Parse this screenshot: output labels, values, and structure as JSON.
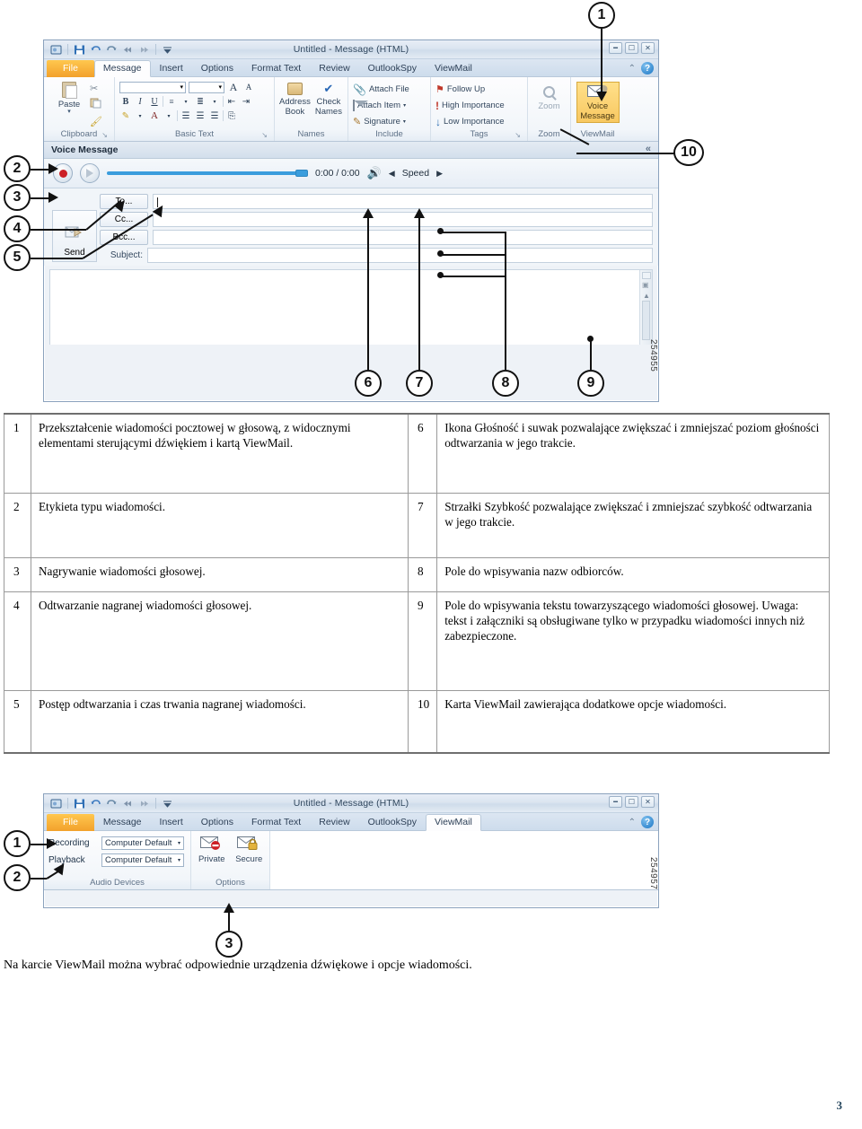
{
  "figure1": {
    "fig_id": "254955",
    "window": {
      "title": "Untitled - Message (HTML)",
      "qat": [
        "office-button-icon",
        "save-icon",
        "undo-icon",
        "redo-icon",
        "previous-item-icon",
        "next-item-icon",
        "customize-qat-icon"
      ],
      "winbtns": [
        "minimize-icon",
        "maximize-icon",
        "close-icon"
      ],
      "tabs": [
        {
          "label": "File",
          "kind": "file"
        },
        {
          "label": "Message",
          "kind": "active"
        },
        {
          "label": "Insert",
          "kind": "normal"
        },
        {
          "label": "Options",
          "kind": "normal"
        },
        {
          "label": "Format Text",
          "kind": "normal"
        },
        {
          "label": "Review",
          "kind": "normal"
        },
        {
          "label": "OutlookSpy",
          "kind": "normal"
        },
        {
          "label": "ViewMail",
          "kind": "normal"
        }
      ],
      "tab_right": {
        "collapse": "⌃",
        "help": "?"
      }
    },
    "ribbon": {
      "clipboard": {
        "paste": "Paste",
        "label": "Clipboard",
        "dialog_launcher": "↘"
      },
      "basic_text": {
        "label": "Basic Text",
        "dialog_launcher": "↘",
        "bold": "B",
        "italic": "I",
        "underline": "U",
        "grow_font": "A",
        "shrink_font": "A"
      },
      "names": {
        "address_book": "Address\nBook",
        "address_book_l1": "Address",
        "address_book_l2": "Book",
        "check_names_l1": "Check",
        "check_names_l2": "Names",
        "label": "Names"
      },
      "include": {
        "attach_file": "Attach File",
        "attach_item": "Attach Item",
        "signature": "Signature",
        "label": "Include"
      },
      "tags": {
        "follow_up": "Follow Up",
        "high_importance": "High Importance",
        "low_importance": "Low Importance",
        "label": "Tags",
        "dialog_launcher": "↘"
      },
      "zoom": {
        "button": "Zoom",
        "label": "Zoom"
      },
      "viewmail": {
        "button_l1": "Voice",
        "button_l2": "Message",
        "label": "ViewMail"
      }
    },
    "voice_message": {
      "header": "Voice Message",
      "collapse_icon": "«",
      "record_icon": "record-icon",
      "play_icon": "play-icon",
      "time": "0:00 / 0:00",
      "volume_icon": "volume-icon",
      "speed_prev_icon": "◀",
      "speed_label": "Speed",
      "speed_next_icon": "▶"
    },
    "compose": {
      "send": "Send",
      "to": "To...",
      "cc": "Cc...",
      "bcc": "Bcc...",
      "subject": "Subject:",
      "to_value": "",
      "cc_value": "",
      "bcc_value": "",
      "subject_value": "",
      "body_value": ""
    },
    "callouts": [
      "1",
      "2",
      "3",
      "4",
      "5",
      "6",
      "7",
      "8",
      "9",
      "10"
    ]
  },
  "legend": {
    "rows": [
      {
        "left_num": "1",
        "left_text": "Przekształcenie wiadomości pocztowej w głosową, z widocznymi elementami sterującymi dźwiękiem i kartą ViewMail.",
        "right_num": "6",
        "right_text": "Ikona Głośność i suwak pozwalające zwiększać i zmniejszać poziom głośności odtwarzania w jego trakcie."
      },
      {
        "left_num": "2",
        "left_text": "Etykieta typu wiadomości.",
        "right_num": "7",
        "right_text": "Strzałki Szybkość pozwalające zwiększać i zmniejszać szybkość odtwarzania w jego trakcie."
      },
      {
        "left_num": "3",
        "left_text": "Nagrywanie wiadomości głosowej.",
        "right_num": "8",
        "right_text": "Pole do wpisywania nazw odbiorców."
      },
      {
        "left_num": "4",
        "left_text": "Odtwarzanie nagranej wiadomości głosowej.",
        "right_num": "9",
        "right_text": "Pole do wpisywania tekstu towarzyszącego wiadomości głosowej. Uwaga: tekst i załączniki są obsługiwane tylko w przypadku wiadomości innych niż zabezpieczone."
      },
      {
        "left_num": "5",
        "left_text": "Postęp odtwarzania i czas trwania nagranej wiadomości.",
        "right_num": "10",
        "right_text": "Karta ViewMail zawierająca dodatkowe opcje wiadomości."
      }
    ]
  },
  "figure2": {
    "fig_id": "254957",
    "window": {
      "title": "Untitled - Message (HTML)",
      "tabs": [
        {
          "label": "File",
          "kind": "file"
        },
        {
          "label": "Message",
          "kind": "normal"
        },
        {
          "label": "Insert",
          "kind": "normal"
        },
        {
          "label": "Options",
          "kind": "normal"
        },
        {
          "label": "Format Text",
          "kind": "normal"
        },
        {
          "label": "Review",
          "kind": "normal"
        },
        {
          "label": "OutlookSpy",
          "kind": "normal"
        },
        {
          "label": "ViewMail",
          "kind": "active"
        }
      ],
      "winbtns": [
        "minimize-icon",
        "maximize-icon",
        "close-icon"
      ],
      "tab_right": {
        "collapse": "⌃",
        "help": "?"
      }
    },
    "ribbon": {
      "audio_devices": {
        "recording_label": "Recording",
        "recording_value": "Computer Default",
        "playback_label": "Playback",
        "playback_value": "Computer Default",
        "group_label": "Audio Devices"
      },
      "options": {
        "private_label": "Private",
        "secure_label": "Secure",
        "group_label": "Options"
      }
    },
    "callouts": [
      "1",
      "2",
      "3"
    ]
  },
  "bottom_caption": "Na karcie ViewMail można wybrać odpowiednie urządzenia dźwiękowe i opcje wiadomości.",
  "page_number": "3"
}
